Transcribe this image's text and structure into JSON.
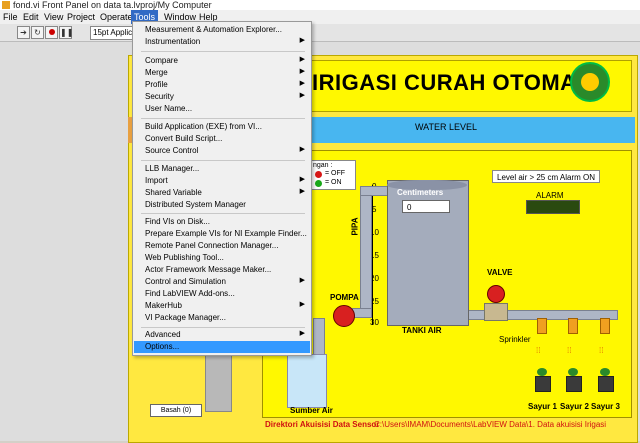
{
  "window": {
    "title": "fond.vi Front Panel on data ta.lvproj/My Computer"
  },
  "menubar": [
    "File",
    "Edit",
    "View",
    "Project",
    "Operate",
    "Tools",
    "Window",
    "Help"
  ],
  "toolbar": {
    "font_select": "15pt Applic"
  },
  "tools_menu": {
    "items": [
      {
        "label": "Measurement & Automation Explorer...",
        "submenu": false
      },
      {
        "label": "Instrumentation",
        "submenu": true
      },
      {
        "label": "Compare",
        "submenu": true
      },
      {
        "label": "Merge",
        "submenu": true
      },
      {
        "label": "Profile",
        "submenu": true
      },
      {
        "label": "Security",
        "submenu": true
      },
      {
        "label": "User Name...",
        "submenu": false
      },
      {
        "label": "Build Application (EXE) from VI...",
        "submenu": false
      },
      {
        "label": "Convert Build Script...",
        "submenu": false
      },
      {
        "label": "Source Control",
        "submenu": true
      },
      {
        "label": "LLB Manager...",
        "submenu": false
      },
      {
        "label": "Import",
        "submenu": true
      },
      {
        "label": "Shared Variable",
        "submenu": true
      },
      {
        "label": "Distributed System Manager",
        "submenu": false
      },
      {
        "label": "Find VIs on Disk...",
        "submenu": false
      },
      {
        "label": "Prepare Example VIs for NI Example Finder...",
        "submenu": false
      },
      {
        "label": "Remote Panel Connection Manager...",
        "submenu": false
      },
      {
        "label": "Web Publishing Tool...",
        "submenu": false
      },
      {
        "label": "Actor Framework Message Maker...",
        "submenu": false
      },
      {
        "label": "Control and Simulation",
        "submenu": true
      },
      {
        "label": "Find LabVIEW Add-ons...",
        "submenu": false
      },
      {
        "label": "MakerHub",
        "submenu": true
      },
      {
        "label": "VI Package Manager...",
        "submenu": false
      },
      {
        "label": "Advanced",
        "submenu": true
      },
      {
        "label": "Options...",
        "submenu": false,
        "highlighted": true
      }
    ]
  },
  "panel": {
    "title": "IRIGASI CURAH OTOMATIS",
    "water_level_label": "WATER LEVEL",
    "legend": {
      "heading": "ngan :",
      "off": "= OFF",
      "on": "= ON"
    },
    "tank_label": "Centimeters",
    "tank_value": "0",
    "tank_name": "TANKI AIR",
    "pipe_label": "PIPA",
    "pump_label": "POMPA",
    "valve_label": "VALVE",
    "sprinkler_label": "Sprinkler",
    "status_text": "Level air > 25 cm  Alarm ON",
    "alarm_label": "ALARM",
    "source_label": "Sumber Air",
    "basah_label": "Basah (0)",
    "scale_ticks": [
      "0",
      "5",
      "10",
      "15",
      "20",
      "25",
      "30"
    ],
    "veg": [
      "Sayur 1",
      "Sayur 2",
      "Sayur 3"
    ],
    "footer_label": "Direktori Akuisisi Data Sensor",
    "footer_path": "C:\\Users\\IMAM\\Documents\\LabVIEW Data\\1. Data akuisisi Irigasi"
  },
  "colors": {
    "panel_yellow": "#fff800",
    "water_bar": "#48b6f0",
    "menu_highlight": "#3399ff",
    "footer_red": "#d01010"
  }
}
